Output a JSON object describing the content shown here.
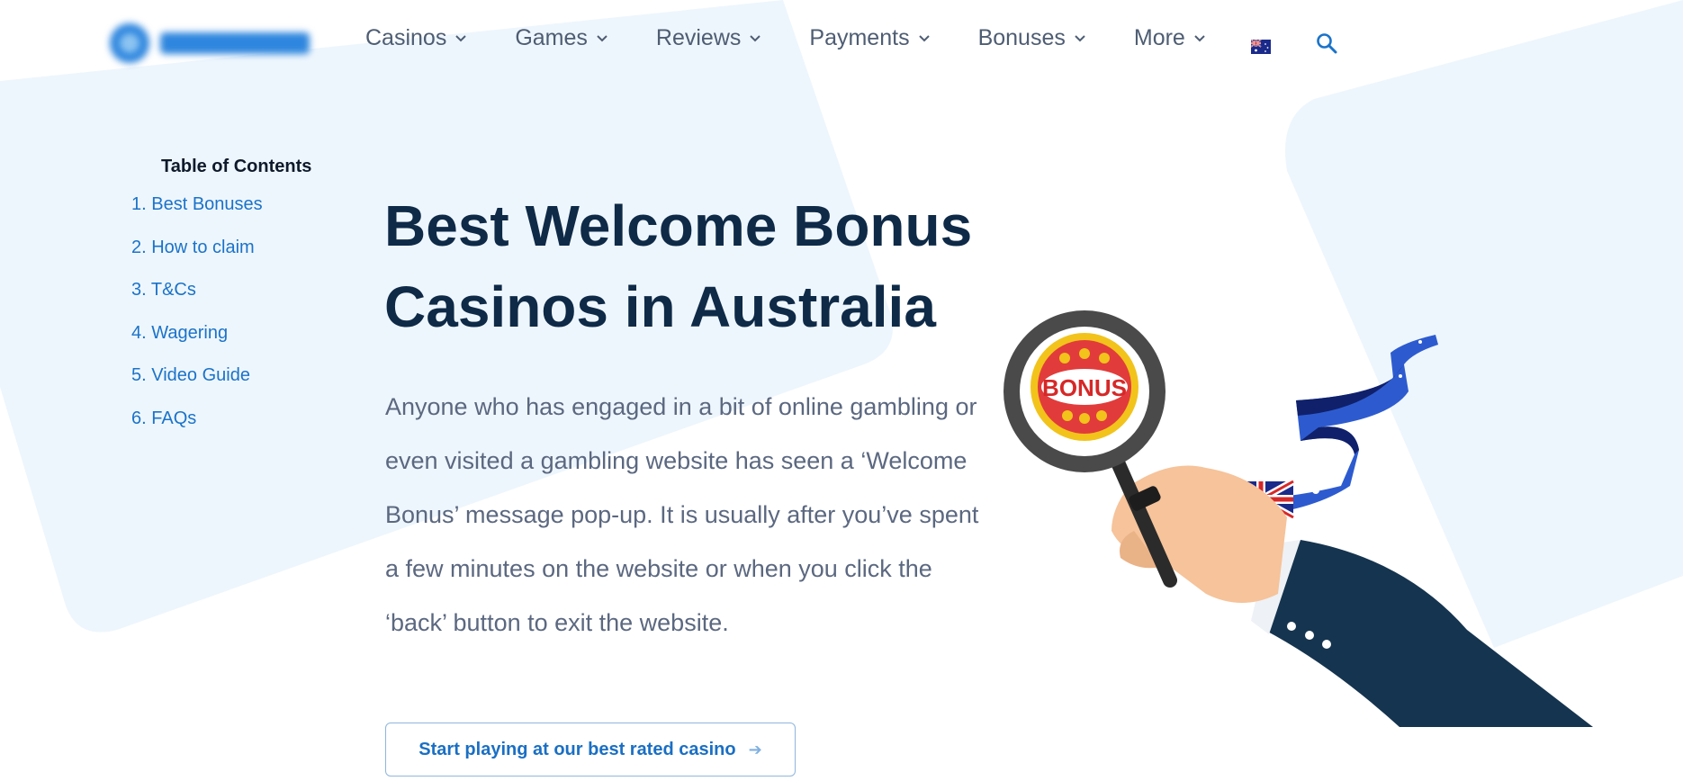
{
  "header": {
    "logo_text": "BETSQUARE",
    "nav": [
      {
        "label": "Casinos"
      },
      {
        "label": "Games"
      },
      {
        "label": "Reviews"
      },
      {
        "label": "Payments"
      },
      {
        "label": "Bonuses"
      },
      {
        "label": "More"
      }
    ],
    "flag_icon": "australia-flag-icon",
    "search_icon": "search-icon"
  },
  "toc": {
    "title": "Table of Contents",
    "items": [
      {
        "label": "1. Best Bonuses"
      },
      {
        "label": "2. How to claim"
      },
      {
        "label": "3. T&Cs"
      },
      {
        "label": "4. Wagering"
      },
      {
        "label": "5. Video Guide"
      },
      {
        "label": "6. FAQs"
      }
    ]
  },
  "hero": {
    "title": "Best Welcome Bonus Casinos in Australia",
    "intro": "Anyone who has engaged in a bit of online gambling or even visited a gambling website has seen a ‘Welcome Bonus’ message pop-up. It is usually after you’ve spent a few minutes on the website or when you click the ‘back’ button to exit the website.",
    "cta_label": "Start playing at our best rated casino",
    "badge_text": "BONUS"
  },
  "colors": {
    "accent": "#1a73c9",
    "heading": "#0e2a47",
    "body_text": "#5b6880",
    "bg_shape": "#eef6fd"
  }
}
